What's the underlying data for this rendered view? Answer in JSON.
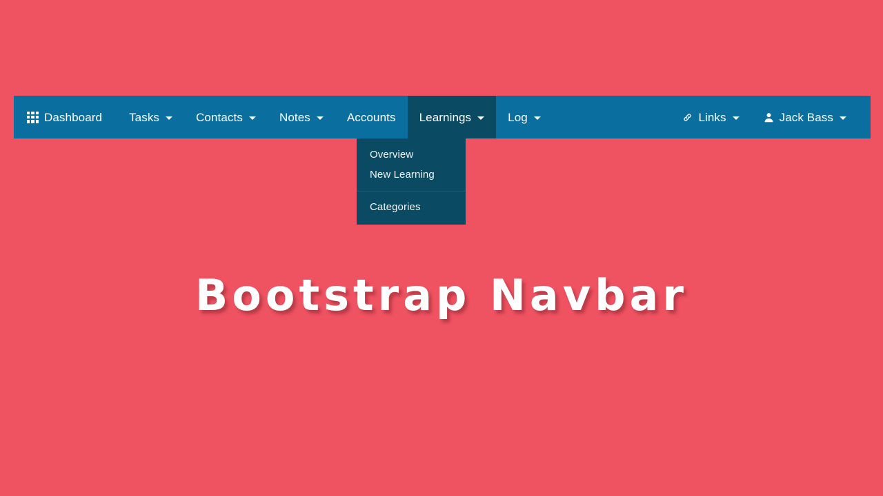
{
  "page": {
    "background_color": "#ef5261",
    "hero_title": "Bootstrap Navbar"
  },
  "navbar": {
    "background_color": "#0a6e9e",
    "active_background_color": "#0b4a63",
    "text_color": "#ffffff",
    "left_items": [
      {
        "label": "Dashboard",
        "icon": "grid-icon",
        "has_caret": false,
        "active": false
      },
      {
        "label": "Tasks",
        "icon": null,
        "has_caret": true,
        "active": false
      },
      {
        "label": "Contacts",
        "icon": null,
        "has_caret": true,
        "active": false
      },
      {
        "label": "Notes",
        "icon": null,
        "has_caret": true,
        "active": false
      },
      {
        "label": "Accounts",
        "icon": null,
        "has_caret": false,
        "active": false
      },
      {
        "label": "Learnings",
        "icon": null,
        "has_caret": true,
        "active": true
      },
      {
        "label": "Log",
        "icon": null,
        "has_caret": true,
        "active": false
      }
    ],
    "right_items": [
      {
        "label": "Links",
        "icon": "link-icon",
        "has_caret": true
      },
      {
        "label": "Jack Bass",
        "icon": "user-icon",
        "has_caret": true
      }
    ]
  },
  "dropdown": {
    "parent": "Learnings",
    "background_color": "#0b4a63",
    "items": [
      {
        "label": "Overview"
      },
      {
        "label": "New Learning"
      }
    ],
    "items_after_divider": [
      {
        "label": "Categories"
      }
    ]
  }
}
